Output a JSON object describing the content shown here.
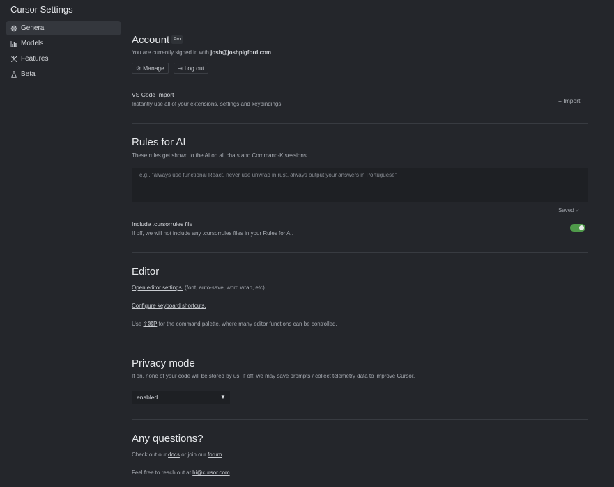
{
  "window": {
    "title": "Cursor Settings"
  },
  "sidebar": {
    "items": [
      {
        "label": "General",
        "icon": "gear-icon",
        "active": true
      },
      {
        "label": "Models",
        "icon": "bar-chart-icon",
        "active": false
      },
      {
        "label": "Features",
        "icon": "tools-icon",
        "active": false
      },
      {
        "label": "Beta",
        "icon": "flask-icon",
        "active": false
      }
    ]
  },
  "account": {
    "title": "Account",
    "badge": "Pro",
    "signed_in_prefix": "You are currently signed in with ",
    "email": "josh@joshpigford.com",
    "signed_in_suffix": ".",
    "manage_label": "Manage",
    "manage_icon": "gear-icon",
    "logout_label": "Log out",
    "logout_icon": "logout-icon"
  },
  "vscode_import": {
    "title": "VS Code Import",
    "description": "Instantly use all of your extensions, settings and keybindings",
    "import_label": "Import",
    "import_icon": "plus-icon"
  },
  "rules": {
    "title": "Rules for AI",
    "description": "These rules get shown to the AI on all chats and Command-K sessions.",
    "placeholder": "e.g., \"always use functional React, never use unwrap in rust, always output your answers in Portuguese\"",
    "saved_status": "Saved ✓",
    "cursorrules_title": "Include .cursorrules file",
    "cursorrules_description": "If off, we will not include any .cursorrules files in your Rules for AI.",
    "cursorrules_enabled": true,
    "toggle_color": "#4f9a4a"
  },
  "editor": {
    "title": "Editor",
    "open_settings_link": "Open editor settings.",
    "open_settings_suffix": " (font, auto-save, word wrap, etc)",
    "shortcuts_link": "Configure keyboard shortcuts.",
    "palette_prefix": "Use ",
    "palette_shortcut": "⇧⌘P",
    "palette_suffix": " for the command palette, where many editor functions can be controlled."
  },
  "privacy": {
    "title": "Privacy mode",
    "description": "If on, none of your code will be stored by us. If off, we may save prompts / collect telemetry data to improve Cursor.",
    "selected": "enabled"
  },
  "questions": {
    "title": "Any questions?",
    "line1_prefix": "Check out our ",
    "docs_link": "docs",
    "line1_middle": " or join our ",
    "forum_link": "forum",
    "line1_suffix": ".",
    "line2_prefix": "Feel free to reach out at ",
    "email_link": "hi@cursor.com",
    "line2_suffix": "."
  }
}
